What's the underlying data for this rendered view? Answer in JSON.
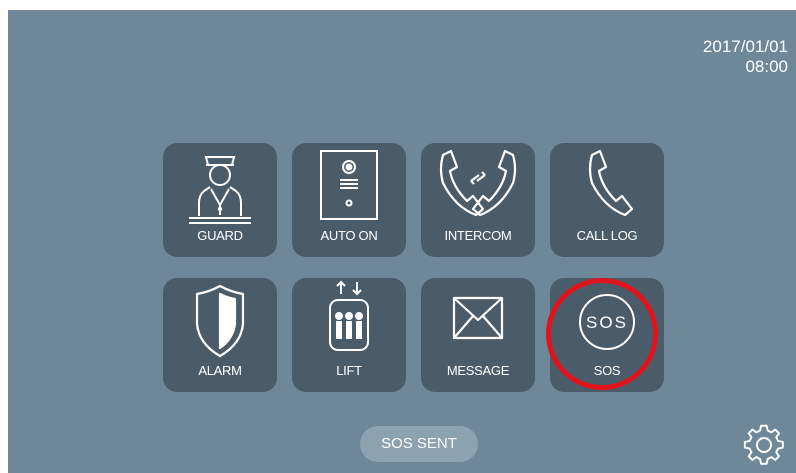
{
  "status_bar": {
    "date": "2017/01/01",
    "time": "08:00"
  },
  "tiles": [
    {
      "label": "GUARD",
      "icon": "guard-icon"
    },
    {
      "label": "AUTO ON",
      "icon": "door-station-icon"
    },
    {
      "label": "INTERCOM",
      "icon": "intercom-icon"
    },
    {
      "label": "CALL LOG",
      "icon": "phone-icon"
    },
    {
      "label": "ALARM",
      "icon": "shield-icon"
    },
    {
      "label": "LIFT",
      "icon": "elevator-icon"
    },
    {
      "label": "MESSAGE",
      "icon": "envelope-icon"
    },
    {
      "label": "SOS",
      "icon": "sos-icon",
      "badge_text": "SOS"
    }
  ],
  "status_message": "SOS SENT",
  "settings": {
    "icon": "gear-icon"
  },
  "colors": {
    "background": "#6e8899",
    "tile": "#4a5c69",
    "pill": "#8ca2b0",
    "highlight": "#e0141c"
  }
}
